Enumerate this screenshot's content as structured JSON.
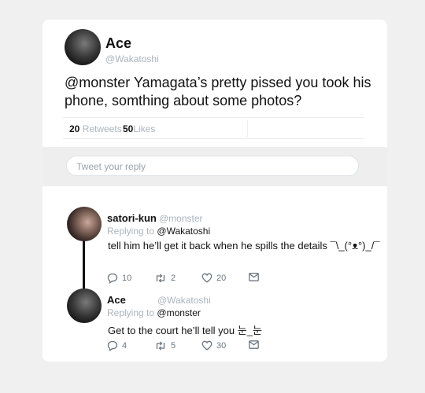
{
  "main_tweet": {
    "name": "Ace",
    "handle": "@Wakatoshi",
    "text": "@monster Yamagata’s pretty pissed you took his phone, somthing about some photos?",
    "retweets_count": "20",
    "retweets_label": "Retweets",
    "likes_count": "50",
    "likes_label": "Likes"
  },
  "reply_box": {
    "placeholder": "Tweet your reply"
  },
  "replies": [
    {
      "name": "satori-kun",
      "handle": "@monster",
      "replying_prefix": "Replying to",
      "replying_to": "@Wakatoshi",
      "text": "tell him he’ll get it back when he spills the details ¯\\_(°ᴥ°)_/¯",
      "replies": "10",
      "retweets": "2",
      "likes": "20"
    },
    {
      "name": "Ace",
      "handle": "@Wakatoshi",
      "replying_prefix": "Replying to",
      "replying_to": "@monster",
      "text": "Get to the court he’ll tell you 눈_눈",
      "replies": "4",
      "retweets": "5",
      "likes": "30"
    }
  ],
  "icons": [
    "reply-icon",
    "retweet-icon",
    "heart-icon",
    "mail-icon"
  ],
  "colors": {
    "background": "#f0f0f0",
    "card": "#ffffff",
    "muted": "#aab4bd",
    "text": "#111111"
  }
}
